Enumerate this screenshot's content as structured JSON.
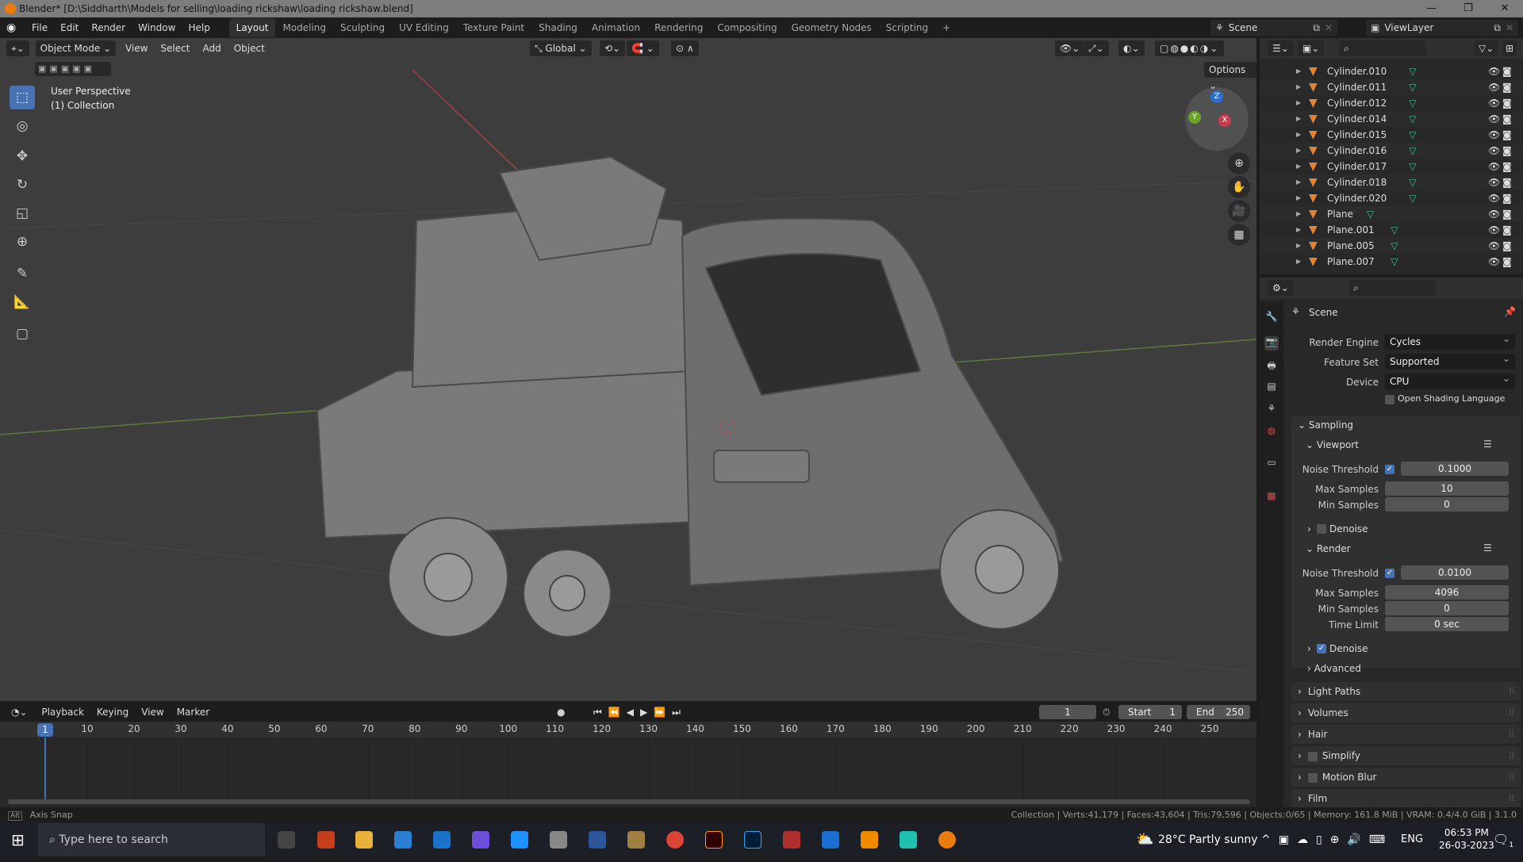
{
  "titlebar": {
    "title": "Blender* [D:\\Siddharth\\Models for selling\\loading rickshaw\\loading rickshaw.blend]",
    "minimize": "—",
    "maximize": "❐",
    "close": "✕"
  },
  "menu": [
    "File",
    "Edit",
    "Render",
    "Window",
    "Help"
  ],
  "workspaces": [
    "Layout",
    "Modeling",
    "Sculpting",
    "UV Editing",
    "Texture Paint",
    "Shading",
    "Animation",
    "Rendering",
    "Compositing",
    "Geometry Nodes",
    "Scripting",
    "+"
  ],
  "scene": {
    "label": "Scene",
    "viewlayer": "ViewLayer"
  },
  "viewport": {
    "mode": "Object Mode",
    "menus": [
      "View",
      "Select",
      "Add",
      "Object"
    ],
    "orientation": "Global",
    "options": "Options",
    "overlay_title": "User Perspective",
    "overlay_sub": "(1) Collection",
    "gizmo": {
      "z": "Z",
      "x": "X",
      "y": "Y"
    }
  },
  "outliner": {
    "items": [
      {
        "name": "Cylinder.010"
      },
      {
        "name": "Cylinder.011"
      },
      {
        "name": "Cylinder.012"
      },
      {
        "name": "Cylinder.014"
      },
      {
        "name": "Cylinder.015"
      },
      {
        "name": "Cylinder.016"
      },
      {
        "name": "Cylinder.017"
      },
      {
        "name": "Cylinder.018"
      },
      {
        "name": "Cylinder.020"
      },
      {
        "name": "Plane"
      },
      {
        "name": "Plane.001"
      },
      {
        "name": "Plane.005"
      },
      {
        "name": "Plane.007"
      }
    ]
  },
  "properties": {
    "context": "Scene",
    "render_engine": {
      "label": "Render Engine",
      "value": "Cycles"
    },
    "feature_set": {
      "label": "Feature Set",
      "value": "Supported"
    },
    "device": {
      "label": "Device",
      "value": "CPU"
    },
    "osl": {
      "label": "Open Shading Language",
      "checked": false
    },
    "sampling": {
      "label": "Sampling",
      "viewport": {
        "label": "Viewport",
        "noise_label": "Noise Threshold",
        "noise": "0.1000",
        "max_label": "Max Samples",
        "max": "10",
        "min_label": "Min Samples",
        "min": "0",
        "denoise": "Denoise",
        "denoise_checked": false
      },
      "render": {
        "label": "Render",
        "noise_label": "Noise Threshold",
        "noise": "0.0100",
        "max_label": "Max Samples",
        "max": "4096",
        "min_label": "Min Samples",
        "min": "0",
        "time_label": "Time Limit",
        "time": "0 sec",
        "denoise": "Denoise",
        "denoise_checked": true
      },
      "advanced": "Advanced"
    },
    "panels": [
      "Light Paths",
      "Volumes",
      "Hair",
      "Simplify",
      "Motion Blur",
      "Film"
    ]
  },
  "timeline": {
    "menus": [
      "Playback",
      "Keying",
      "View",
      "Marker"
    ],
    "current_frame": "1",
    "start_label": "Start",
    "start": "1",
    "end_label": "End",
    "end": "250",
    "ticks": [
      10,
      20,
      30,
      40,
      50,
      60,
      70,
      80,
      90,
      100,
      110,
      120,
      130,
      140,
      150,
      160,
      170,
      180,
      190,
      200,
      210,
      220,
      230,
      240,
      250
    ],
    "playhead": 1
  },
  "status": {
    "left": "Axis Snap",
    "alt": "Alt",
    "right": "Collection | Verts:41,179 | Faces:43,604 | Tris:79,596 | Objects:0/65 | Memory: 161.8 MiB | VRAM: 0.4/4.0 GiB | 3.1.0"
  },
  "taskbar": {
    "search": "Type here to search",
    "weather": "28°C  Partly sunny",
    "lang": "ENG",
    "time": "06:53 PM",
    "date": "26-03-2023",
    "notif": "1"
  }
}
